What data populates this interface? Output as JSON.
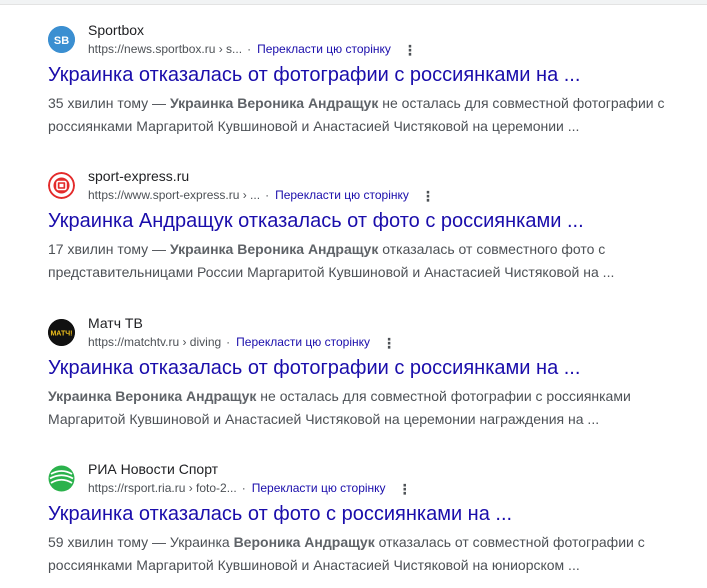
{
  "results": [
    {
      "site_name": "Sportbox",
      "url": "https://news.sportbox.ru › s...",
      "translate": "Перекласти цю сторінку",
      "favicon": "sportbox-icon",
      "favicon_text": "SB",
      "favicon_color": "#3b8fd1",
      "title": "Украинка отказалась от фотографии с россиянками на ...",
      "snippet": {
        "prefix": "35 хвилин тому — ",
        "bold": "Украинка Вероника Андращук",
        "rest1": " не осталась для совместной фотографии с",
        "line2": "россиянками Маргаритой Кувшиновой и Анастасией Чистяковой на церемонии ..."
      }
    },
    {
      "site_name": "sport-express.ru",
      "url": "https://www.sport-express.ru › ...",
      "translate": "Перекласти цю сторінку",
      "favicon": "sport-express-icon",
      "favicon_color": "#e32b2b",
      "title": "Украинка Андращук отказалась от фото с россиянками ...",
      "snippet": {
        "prefix": "17 хвилин тому — ",
        "bold": "Украинка Вероника Андращук",
        "rest1": " отказалась от совместного фото с",
        "line2": "представительницами России Маргаритой Кувшиновой и Анастасией Чистяковой на ..."
      }
    },
    {
      "site_name": "Матч ТВ",
      "url": "https://matchtv.ru › diving",
      "translate": "Перекласти цю сторінку",
      "favicon": "matchtv-icon",
      "favicon_text": "МАТЧ!",
      "favicon_color": "#111111",
      "title": "Украинка отказалась от фотографии с россиянками на ...",
      "snippet": {
        "prefix": "",
        "bold": "Украинка Вероника Андращук",
        "rest1": " не осталась для совместной фотографии с россиянками",
        "line2": "Маргаритой Кувшиновой и Анастасией Чистяковой на церемонии награждения на ..."
      }
    },
    {
      "site_name": "РИА Новости Спорт",
      "url": "https://rsport.ria.ru › foto-2...",
      "translate": "Перекласти цю сторінку",
      "favicon": "ria-sport-icon",
      "favicon_color": "#2bb24c",
      "title": "Украинка отказалась от фото с россиянками на ...",
      "snippet": {
        "prefix": "59 хвилин тому — Украинка ",
        "bold": "Вероника Андращук",
        "rest1": " отказалась от совместной фотографии с",
        "line2": "россиянками Маргаритой Кувшиновой и Анастасией Чистяковой на юниорском ..."
      }
    }
  ]
}
